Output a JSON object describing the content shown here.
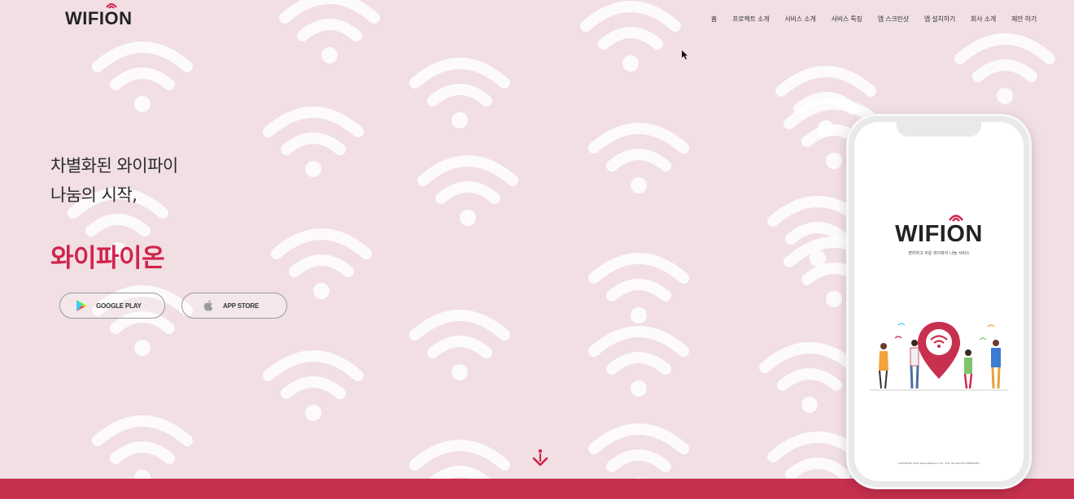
{
  "brand": {
    "logo_text": "WIFION",
    "accent_color": "#d0234a"
  },
  "nav": {
    "items": [
      "홈",
      "프로젝트 소개",
      "서비스 소개",
      "서비스 특징",
      "앱 스크린샷",
      "앱 설치하기",
      "회사 소개",
      "제안 하기"
    ]
  },
  "hero": {
    "line1": "차별화된 와이파이",
    "line2": "나눔의 시작,",
    "brand_korean": "와이파이온"
  },
  "store_buttons": {
    "google_label": "GOOGLE PLAY",
    "apple_label": "APP STORE"
  },
  "phone": {
    "logo_text": "WIFION",
    "tagline": "편리하고 쉬운 와이파이 나눔 서비스",
    "copyright": "COPYRIGHT 2021 WeCanNetwork CO., LTD. ALL RIGHTS RESERVED."
  },
  "colors": {
    "background": "#f1dfe3",
    "bottom_bar": "#c8304f",
    "brand_red": "#d0234a"
  },
  "icons": [
    "wifi-pattern-icon",
    "google-play-icon",
    "apple-icon",
    "scroll-down-icon",
    "map-pin-wifi-icon",
    "mouse-cursor-icon"
  ]
}
